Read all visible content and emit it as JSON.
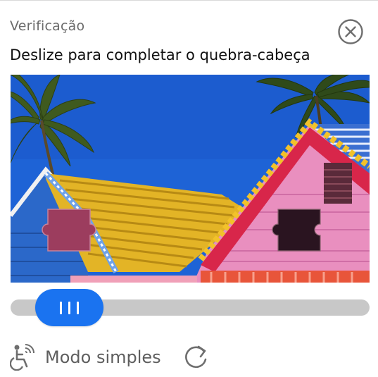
{
  "header": {
    "title": "Verificação",
    "close_icon": "close-circle-icon"
  },
  "instruction": "Deslize para completar o quebra-cabeça",
  "puzzle": {
    "image": "colorful-houses-with-palm-trees",
    "piece_icon": "puzzle-piece-icon",
    "slot_icon": "puzzle-slot-icon"
  },
  "slider": {
    "handle_icon": "grip-lines-icon",
    "accent_color": "#1a73f0",
    "track_color": "#c8c8c8"
  },
  "footer": {
    "simple_mode_label": "Modo simples",
    "simple_mode_icon": "accessibility-wheelchair-icon",
    "refresh_icon": "refresh-icon"
  }
}
